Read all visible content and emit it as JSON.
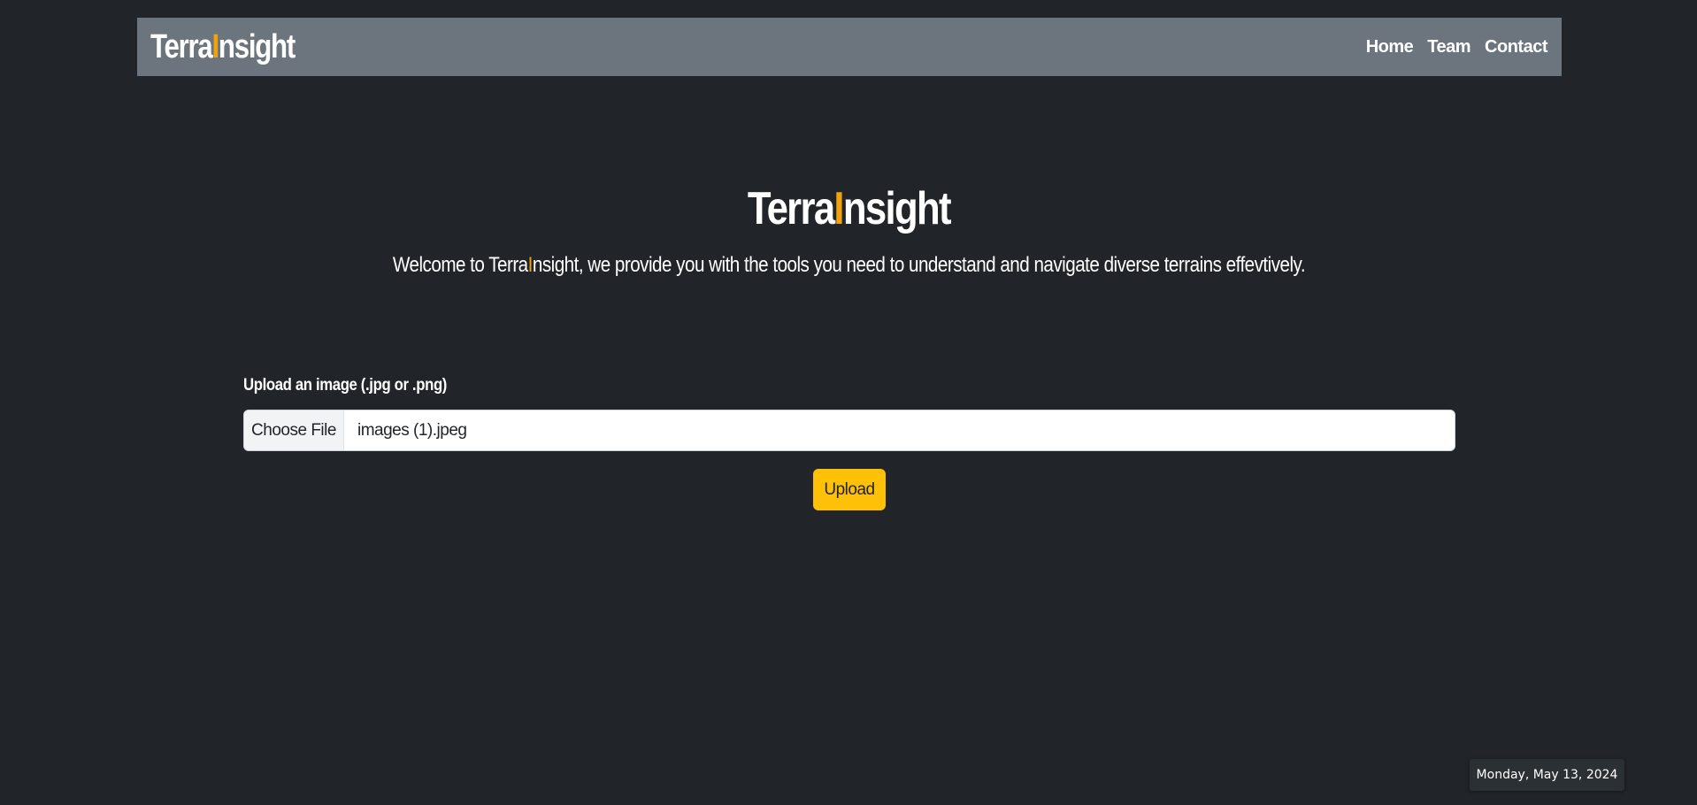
{
  "navbar": {
    "brand": {
      "prefix": "Terra",
      "accent": "I",
      "suffix": "nsight"
    },
    "links": [
      "Home",
      "Team",
      "Contact"
    ]
  },
  "hero": {
    "title": {
      "prefix": "Terra",
      "accent": "I",
      "suffix": "nsight"
    },
    "subtitle": {
      "before": "Welcome to Terra",
      "accent": "I",
      "after": "nsight, we provide you with the tools you need to understand and navigate diverse terrains effevtively."
    }
  },
  "upload": {
    "label": "Upload an image (.jpg or .png)",
    "choose_label": "Choose File",
    "file_name": "images (1).jpeg",
    "button_label": "Upload"
  },
  "footer": {
    "date": "Monday, May 13, 2024"
  },
  "colors": {
    "background": "#212529",
    "navbar": "#6c757d",
    "accent": "#f0a30a",
    "button": "#ffc107"
  }
}
